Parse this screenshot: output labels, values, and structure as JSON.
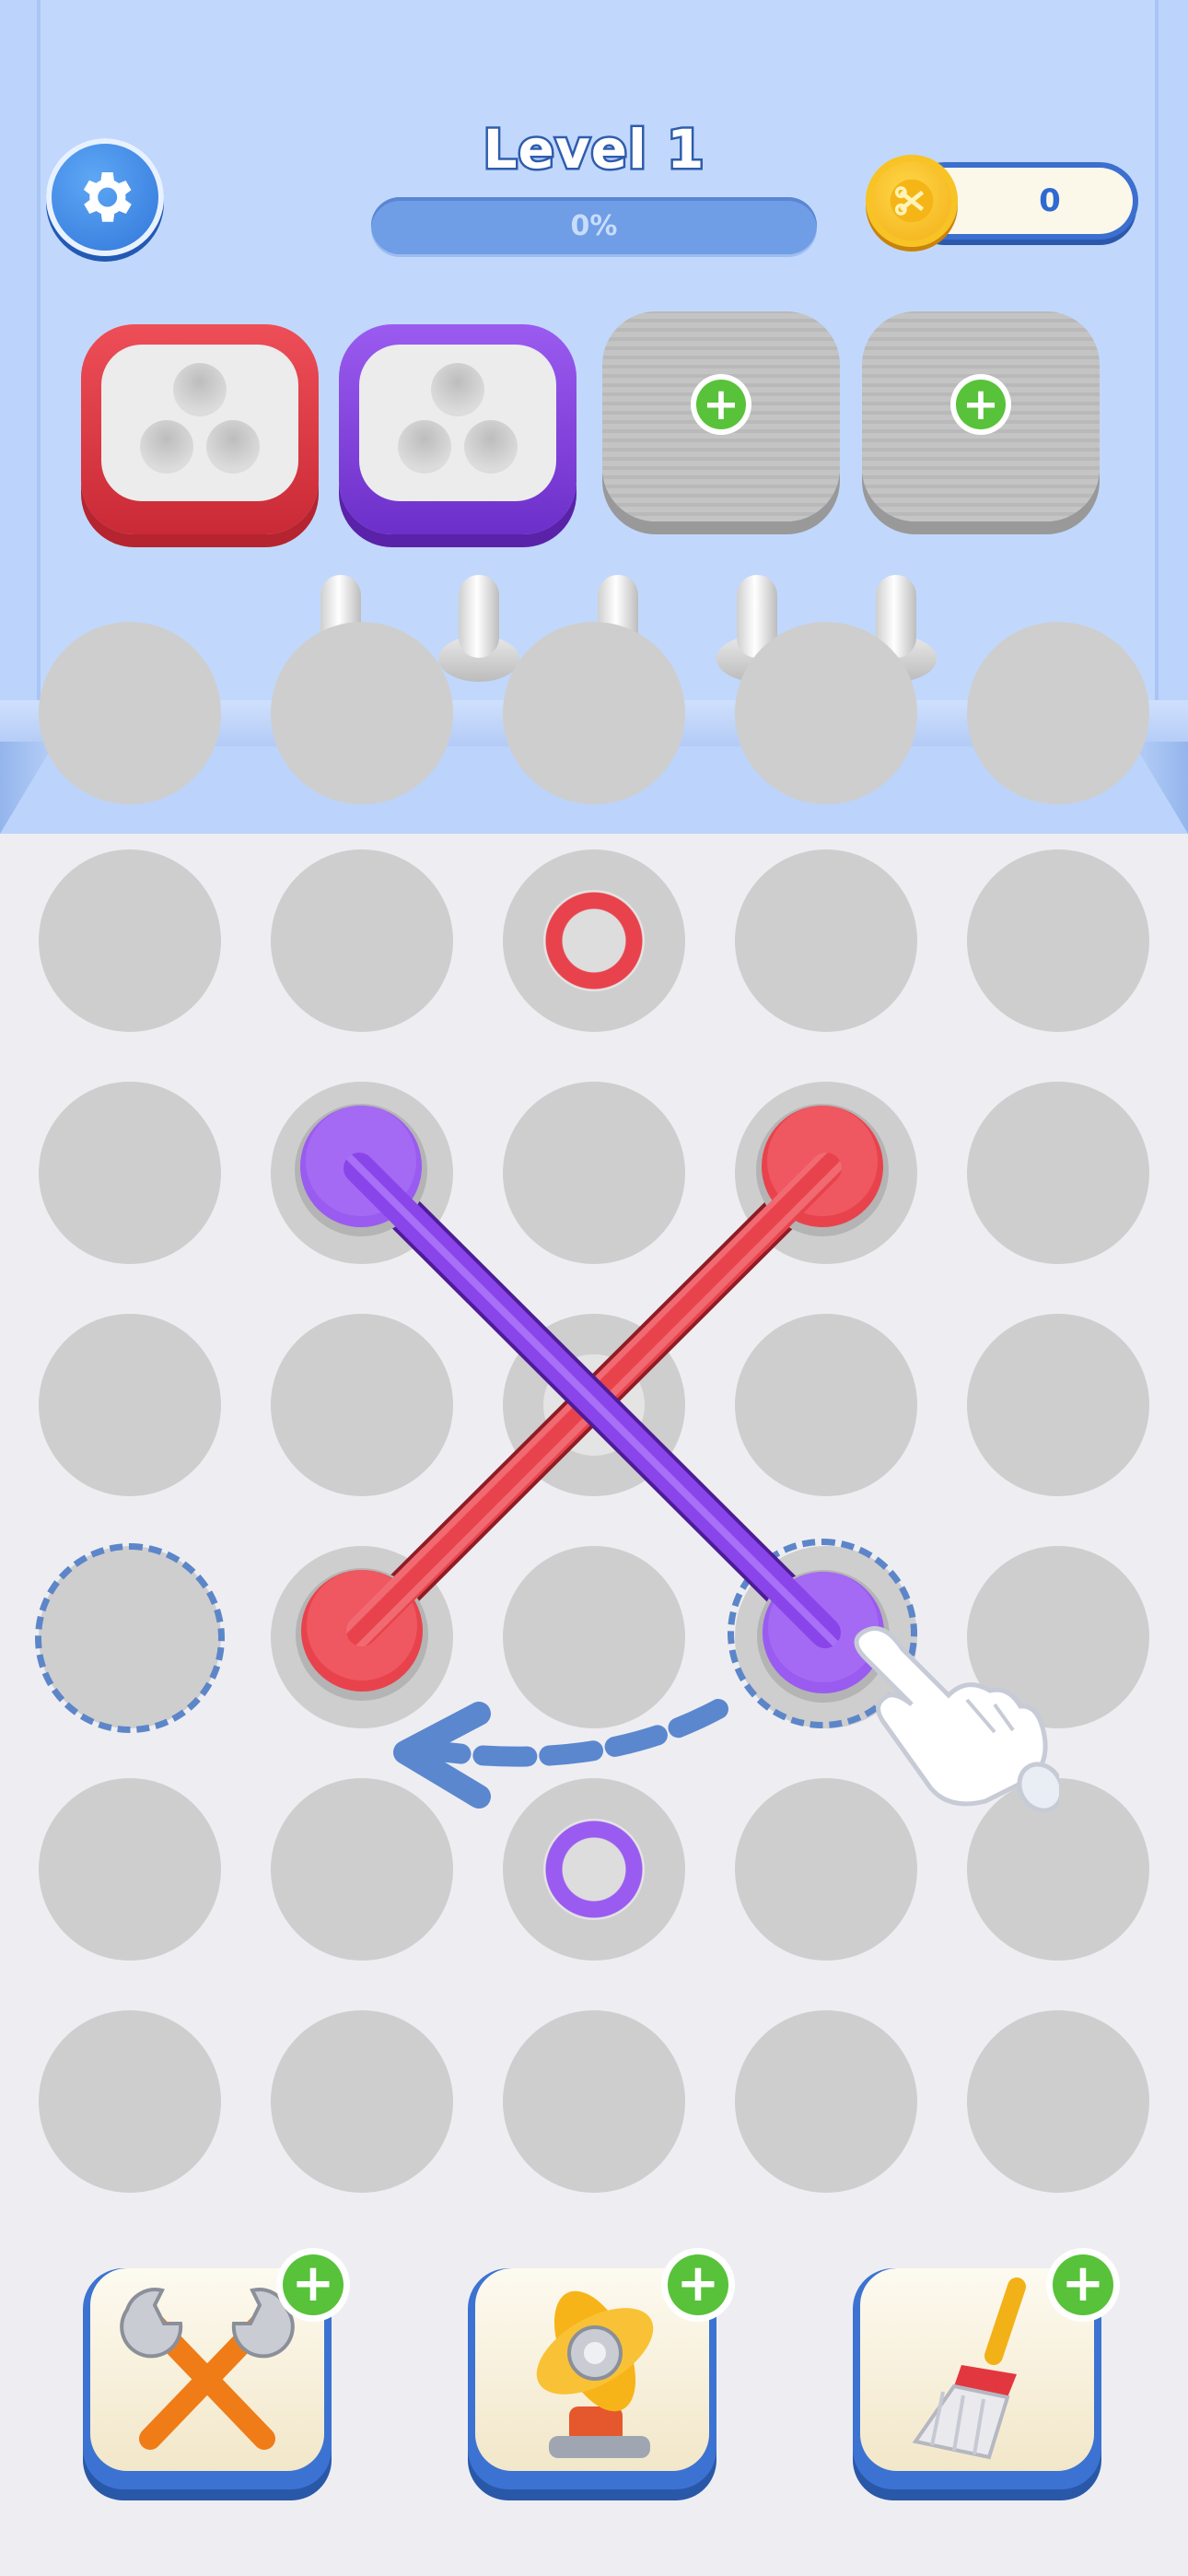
{
  "header": {
    "level_title": "Level 1",
    "progress_text": "0%",
    "progress_value": 0,
    "coins": "0"
  },
  "spools": [
    {
      "color": "red",
      "state": "active"
    },
    {
      "color": "purple",
      "state": "active"
    },
    {
      "color": "grey",
      "state": "locked"
    },
    {
      "color": "grey",
      "state": "locked"
    }
  ],
  "pegs_count": 5,
  "board": {
    "pins": [
      {
        "color": "red",
        "kind": "ring"
      },
      {
        "color": "purple",
        "kind": "rope-end"
      },
      {
        "color": "red",
        "kind": "rope-end"
      },
      {
        "color": "red",
        "kind": "rope-end"
      },
      {
        "color": "purple",
        "kind": "rope-end"
      },
      {
        "color": "purple",
        "kind": "ring"
      }
    ],
    "colors": {
      "red": "#e8434d",
      "purple": "#9a5bf0",
      "hole": "#cecece",
      "dashed": "#5d86c9"
    }
  },
  "tools": [
    {
      "name": "wrench-tool",
      "icon": "crossed-wrenches-icon"
    },
    {
      "name": "fan-tool",
      "icon": "fan-icon"
    },
    {
      "name": "broom-tool",
      "icon": "broom-icon"
    }
  ]
}
